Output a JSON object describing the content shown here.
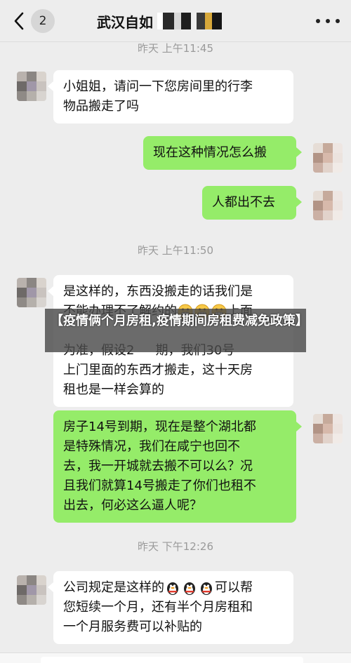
{
  "header": {
    "back_badge": "2",
    "title": "武汉自如"
  },
  "messages": [
    {
      "type": "timestamp",
      "text": "昨天 上午11:45"
    },
    {
      "type": "in",
      "lines": [
        "小姐姐，请问一下您房间里的行李",
        "物品搬走了吗"
      ]
    },
    {
      "type": "out",
      "lines": [
        "现在这种情况怎么搬"
      ]
    },
    {
      "type": "out",
      "lines": [
        "人都出不去"
      ]
    },
    {
      "type": "timestamp",
      "text": "昨天 上午11:50"
    },
    {
      "type": "in",
      "lines": [
        "是这样的，东西没搬走的话我们是",
        "不能办理不了解约的",
        "上面",
        "为准，假设2",
        "期，我们30号",
        "上门里面的东西才搬走，这十天房",
        "租也是一样会算的"
      ]
    },
    {
      "type": "out",
      "lines": [
        "房子14号到期，现在是整个湖北都",
        "是特殊情况，我们在咸宁也回不",
        "去，我一开城就去搬不可以么？况",
        "且我们就算14号搬走了你们也租不",
        "出去，何必这么逼人呢？"
      ]
    },
    {
      "type": "timestamp",
      "text": "昨天 下午12:26"
    },
    {
      "type": "in",
      "lines": [
        "公司规定是这样的",
        "可以帮",
        "您短续一个月，还有半个月房租和",
        "一个月服务费可以补贴的"
      ]
    }
  ],
  "overlay": {
    "text": "【疫情俩个月房租,疫情期间房租费减免政策】"
  },
  "icons": {
    "back": "chevron-left-icon",
    "more": "more-dots-icon",
    "emoji_grimace": "grimace-emoji-icon",
    "emoji_penguin": "penguin-emoji-icon"
  },
  "colors": {
    "outgoing_bubble": "#95ec69",
    "incoming_bubble": "#ffffff",
    "background": "#ededed"
  }
}
